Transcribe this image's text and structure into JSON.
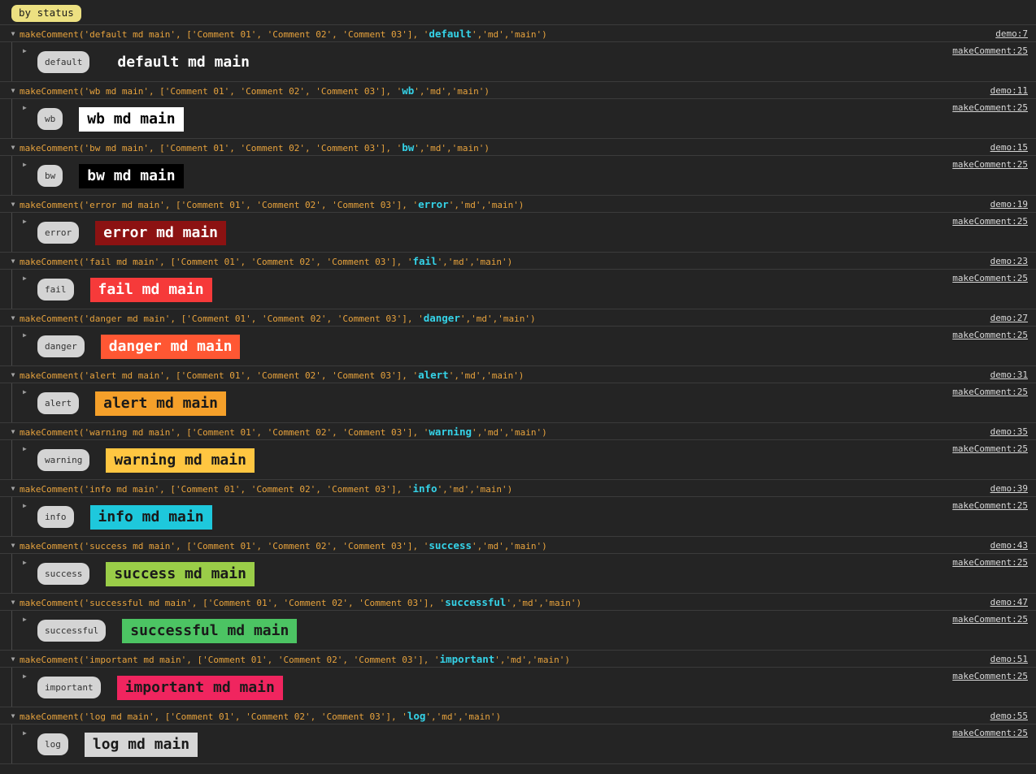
{
  "badge": {
    "label": "by status"
  },
  "colors": {
    "console_bg": "#242424",
    "separator": "#3b3b3b",
    "badge_bg": "#ece081",
    "header_code": "#e8a33d",
    "header_status": "#35d3e8",
    "chip_bg": "#d4d4d4",
    "link": "#d8d8d8"
  },
  "header_template": {
    "prefix": "makeComment('",
    "middle": " md main', ['Comment 01', 'Comment 02', 'Comment 03'], '",
    "suffix": "','md','main')"
  },
  "entries": [
    {
      "status": "default",
      "header_code_pre": "makeComment('default md main', ['Comment 01', 'Comment 02', 'Comment 03'], '",
      "header_status": "default",
      "header_code_post": "','md','main')",
      "chip": "default",
      "message": "default md main",
      "bg": "transparent",
      "fg": "#ffffff",
      "link_top": "demo:7",
      "link_body": "makeComment:25"
    },
    {
      "status": "wb",
      "header_code_pre": "makeComment('wb md main', ['Comment 01', 'Comment 02', 'Comment 03'], '",
      "header_status": "wb",
      "header_code_post": "','md','main')",
      "chip": "wb",
      "message": "wb md main",
      "bg": "#ffffff",
      "fg": "#000000",
      "link_top": "demo:11",
      "link_body": "makeComment:25"
    },
    {
      "status": "bw",
      "header_code_pre": "makeComment('bw md main', ['Comment 01', 'Comment 02', 'Comment 03'], '",
      "header_status": "bw",
      "header_code_post": "','md','main')",
      "chip": "bw",
      "message": "bw md main",
      "bg": "#000000",
      "fg": "#ffffff",
      "link_top": "demo:15",
      "link_body": "makeComment:25"
    },
    {
      "status": "error",
      "header_code_pre": "makeComment('error md main', ['Comment 01', 'Comment 02', 'Comment 03'], '",
      "header_status": "error",
      "header_code_post": "','md','main')",
      "chip": "error",
      "message": "error md main",
      "bg": "#8c1212",
      "fg": "#ffffff",
      "link_top": "demo:19",
      "link_body": "makeComment:25"
    },
    {
      "status": "fail",
      "header_code_pre": "makeComment('fail md main', ['Comment 01', 'Comment 02', 'Comment 03'], '",
      "header_status": "fail",
      "header_code_post": "','md','main')",
      "chip": "fail",
      "message": "fail md main",
      "bg": "#f63a3a",
      "fg": "#ffffff",
      "link_top": "demo:23",
      "link_body": "makeComment:25"
    },
    {
      "status": "danger",
      "header_code_pre": "makeComment('danger md main', ['Comment 01', 'Comment 02', 'Comment 03'], '",
      "header_status": "danger",
      "header_code_post": "','md','main')",
      "chip": "danger",
      "message": "danger md main",
      "bg": "#ff5733",
      "fg": "#ffffff",
      "link_top": "demo:27",
      "link_body": "makeComment:25"
    },
    {
      "status": "alert",
      "header_code_pre": "makeComment('alert md main', ['Comment 01', 'Comment 02', 'Comment 03'], '",
      "header_status": "alert",
      "header_code_post": "','md','main')",
      "chip": "alert",
      "message": "alert md main",
      "bg": "#f5a02a",
      "fg": "#1a1a1a",
      "link_top": "demo:31",
      "link_body": "makeComment:25"
    },
    {
      "status": "warning",
      "header_code_pre": "makeComment('warning md main', ['Comment 01', 'Comment 02', 'Comment 03'], '",
      "header_status": "warning",
      "header_code_post": "','md','main')",
      "chip": "warning",
      "message": "warning md main",
      "bg": "#ffc641",
      "fg": "#1a1a1a",
      "link_top": "demo:35",
      "link_body": "makeComment:25"
    },
    {
      "status": "info",
      "header_code_pre": "makeComment('info md main', ['Comment 01', 'Comment 02', 'Comment 03'], '",
      "header_status": "info",
      "header_code_post": "','md','main')",
      "chip": "info",
      "message": "info md main",
      "bg": "#1ec8dc",
      "fg": "#1a1a1a",
      "link_top": "demo:39",
      "link_body": "makeComment:25"
    },
    {
      "status": "success",
      "header_code_pre": "makeComment('success md main', ['Comment 01', 'Comment 02', 'Comment 03'], '",
      "header_status": "success",
      "header_code_post": "','md','main')",
      "chip": "success",
      "message": "success md main",
      "bg": "#9acd48",
      "fg": "#1a1a1a",
      "link_top": "demo:43",
      "link_body": "makeComment:25"
    },
    {
      "status": "successful",
      "header_code_pre": "makeComment('successful md main', ['Comment 01', 'Comment 02', 'Comment 03'], '",
      "header_status": "successful",
      "header_code_post": "','md','main')",
      "chip": "successful",
      "message": "successful md main",
      "bg": "#4cc463",
      "fg": "#1a1a1a",
      "link_top": "demo:47",
      "link_body": "makeComment:25"
    },
    {
      "status": "important",
      "header_code_pre": "makeComment('important md main', ['Comment 01', 'Comment 02', 'Comment 03'], '",
      "header_status": "important",
      "header_code_post": "','md','main')",
      "chip": "important",
      "message": "important md main",
      "bg": "#f0255f",
      "fg": "#1a1a1a",
      "link_top": "demo:51",
      "link_body": "makeComment:25"
    },
    {
      "status": "log",
      "header_code_pre": "makeComment('log md main', ['Comment 01', 'Comment 02', 'Comment 03'], '",
      "header_status": "log",
      "header_code_post": "','md','main')",
      "chip": "log",
      "message": "log md main",
      "bg": "#d6d6d6",
      "fg": "#1a1a1a",
      "link_top": "demo:55",
      "link_body": "makeComment:25"
    }
  ]
}
